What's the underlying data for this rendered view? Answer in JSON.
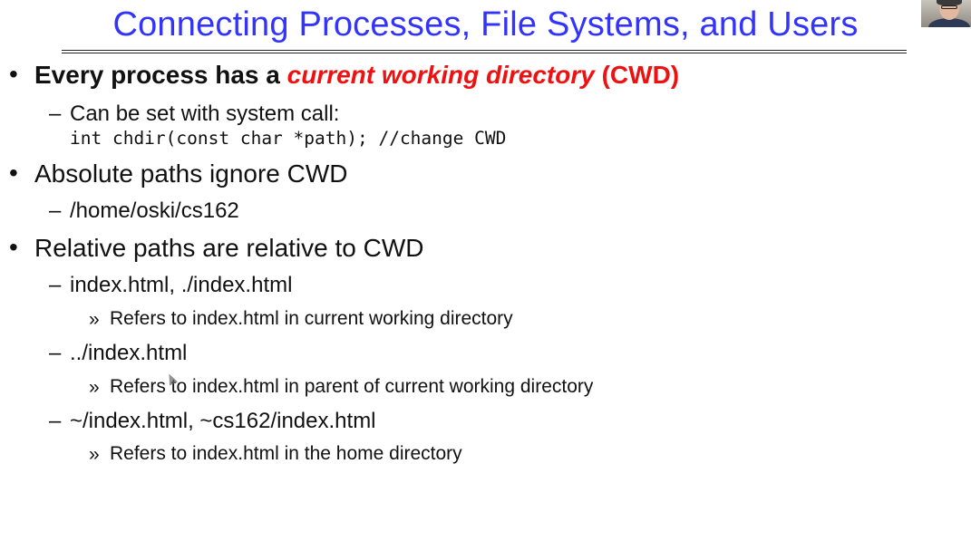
{
  "title": "Connecting Processes, File Systems, and Users",
  "bullets": {
    "b1": {
      "marker": "•",
      "text_before": "Every process has a ",
      "text_emph": "current working directory",
      "text_after": " (CWD)",
      "sub1": {
        "dash": "–",
        "text": "Can be set with system call:",
        "code": "int chdir(const char *path); //change CWD"
      }
    },
    "b2": {
      "marker": "•",
      "text": "Absolute paths ignore CWD",
      "sub1": {
        "dash": "–",
        "text": "/home/oski/cs162"
      }
    },
    "b3": {
      "marker": "•",
      "text": "Relative paths are relative to CWD",
      "sub1": {
        "dash": "–",
        "text": "index.html, ./index.html",
        "detail_marker": "»",
        "detail": "Refers to index.html in current working directory"
      },
      "sub2": {
        "dash": "–",
        "text": "../index.html",
        "detail_marker": "»",
        "detail": "Refers to index.html in parent of current working directory"
      },
      "sub3": {
        "dash": "–",
        "text": "~/index.html, ~cs162/index.html",
        "detail_marker": "»",
        "detail": "Refers to index.html in the home directory"
      }
    }
  },
  "colors": {
    "title": "#3333ff",
    "emphasis": "#ee1111",
    "text": "#111111",
    "background": "#ffffff"
  }
}
